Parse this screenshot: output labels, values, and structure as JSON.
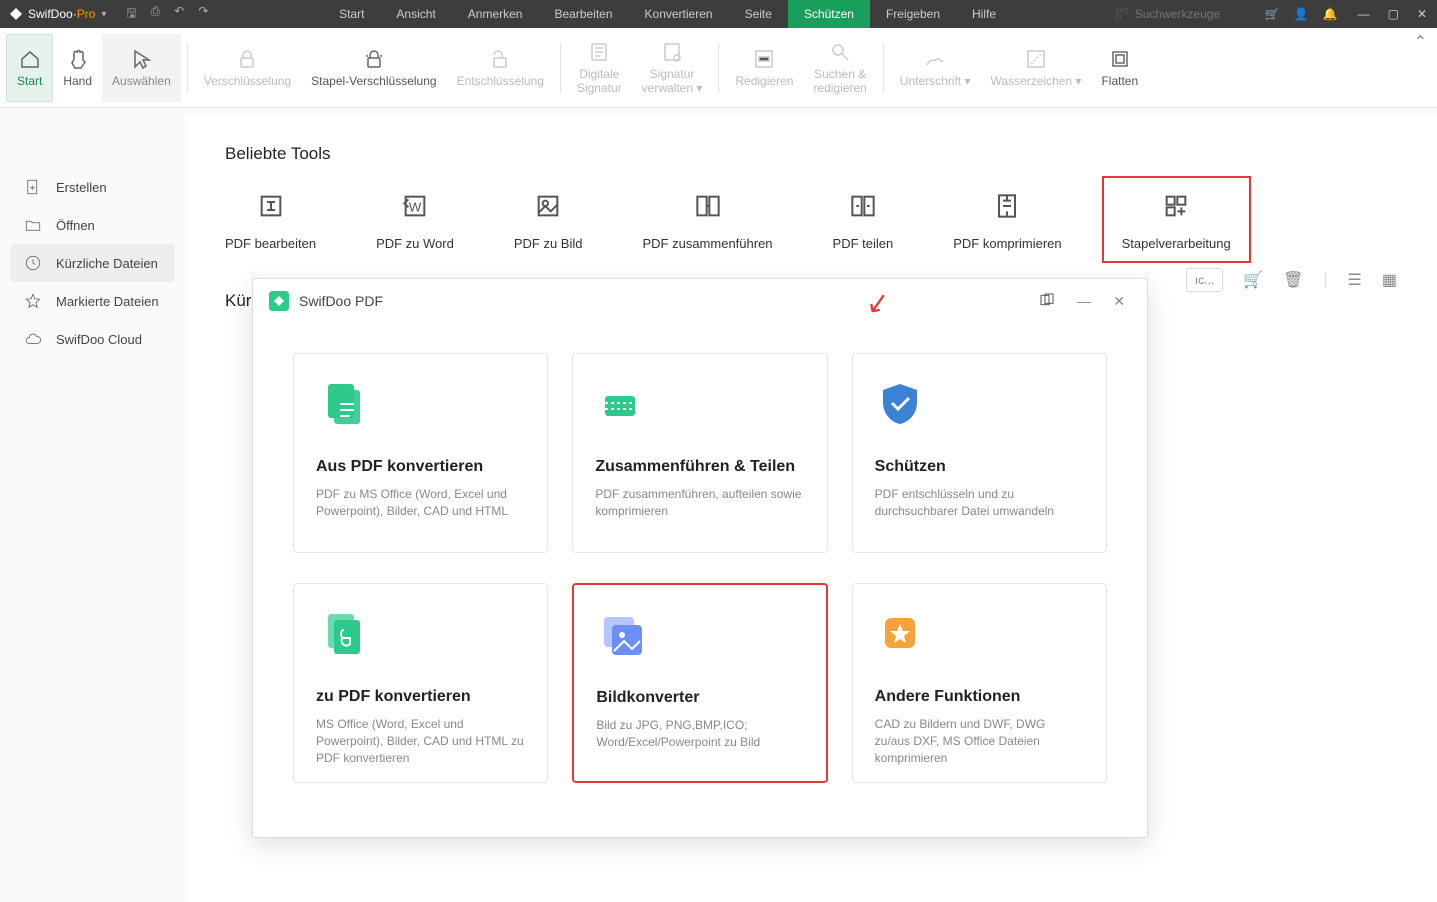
{
  "app": {
    "name": "SwifDoo",
    "suffix": "Pro"
  },
  "menubar": [
    "Start",
    "Ansicht",
    "Anmerken",
    "Bearbeiten",
    "Konvertieren",
    "Seite",
    "Schützen",
    "Freigeben",
    "Hilfe"
  ],
  "menubar_active": 6,
  "search_placeholder": "Suchwerkzeuge",
  "ribbon": [
    {
      "label": "Start",
      "active": true
    },
    {
      "label": "Hand"
    },
    {
      "label": "Auswählen",
      "lite": true
    },
    {
      "sep": true
    },
    {
      "label": "Verschlüsselung",
      "dis": true
    },
    {
      "label": "Stapel-Verschlüsselung"
    },
    {
      "label": "Entschlüsselung",
      "dis": true
    },
    {
      "sep": true
    },
    {
      "label": "Digitale\nSignatur",
      "dis": true
    },
    {
      "label": "Signatur\nverwalten",
      "dd": true,
      "dis": true
    },
    {
      "sep": true
    },
    {
      "label": "Redigieren",
      "dis": true
    },
    {
      "label": "Suchen &\nredigieren",
      "dis": true
    },
    {
      "sep": true
    },
    {
      "label": "Unterschrift",
      "dd": true,
      "dis": true
    },
    {
      "label": "Wasserzeichen",
      "dd": true,
      "dis": true
    },
    {
      "label": "Flatten"
    }
  ],
  "sidebar": [
    {
      "label": "Erstellen",
      "icon": "file-plus"
    },
    {
      "label": "Öffnen",
      "icon": "folder-open"
    },
    {
      "label": "Kürzliche Dateien",
      "icon": "clock",
      "active": true
    },
    {
      "label": "Markierte Dateien",
      "icon": "star"
    },
    {
      "label": "SwifDoo Cloud",
      "icon": "cloud"
    }
  ],
  "content": {
    "tools_title": "Beliebte Tools",
    "recent_title": "Kürzli",
    "search_partial": "ıc..."
  },
  "tools": [
    {
      "label": "PDF bearbeiten"
    },
    {
      "label": "PDF zu Word"
    },
    {
      "label": "PDF zu Bild"
    },
    {
      "label": "PDF zusammenführen"
    },
    {
      "label": "PDF teilen"
    },
    {
      "label": "PDF komprimieren"
    },
    {
      "label": "Stapelverarbeitung",
      "highlight": true
    }
  ],
  "dialog": {
    "title": "SwifDoo PDF",
    "cards": [
      {
        "title": "Aus PDF konvertieren",
        "desc": "PDF zu MS Office (Word, Excel und Powerpoint), Bilder, CAD und HTML",
        "color": "#2eca8b",
        "icon": "doc"
      },
      {
        "title": "Zusammenführen & Teilen",
        "desc": "PDF zusammenführen, aufteilen sowie komprimieren",
        "color": "#2eca8b",
        "icon": "split"
      },
      {
        "title": "Schützen",
        "desc": "PDF entschlüsseln und zu durchsuchbarer Datei umwandeln",
        "color": "#3b82d4",
        "icon": "shield"
      },
      {
        "title": "zu PDF konvertieren",
        "desc": "MS Office (Word, Excel und Powerpoint), Bilder, CAD und HTML zu PDF konvertieren",
        "color": "#2eca8b",
        "icon": "pdf"
      },
      {
        "title": "Bildkonverter",
        "desc": "Bild zu JPG, PNG,BMP,ICO; Word/Excel/Powerpoint zu Bild",
        "color": "#6b8ff5",
        "icon": "image",
        "hl": true
      },
      {
        "title": "Andere Funktionen",
        "desc": "CAD zu Bildern und DWF, DWG zu/aus DXF, MS Office Dateien komprimieren",
        "color": "#f5a33b",
        "icon": "star"
      }
    ]
  }
}
